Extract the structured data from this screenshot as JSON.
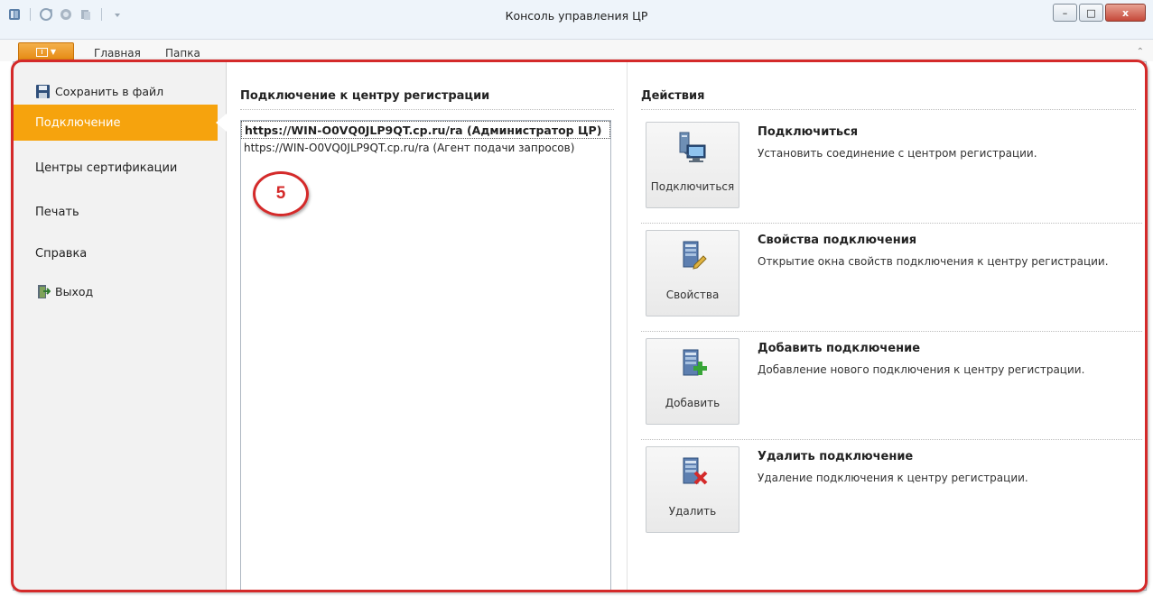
{
  "window": {
    "title": "Консоль управления ЦР",
    "buttons": {
      "minimize": "–",
      "maximize": "□",
      "close": "x"
    }
  },
  "quick_access": [
    "app-icon",
    "refresh-icon",
    "connect-icon",
    "servers-icon",
    "dropdown-icon"
  ],
  "ribbon": {
    "tabs": [
      {
        "label": "Главная"
      },
      {
        "label": "Папка"
      }
    ],
    "collapse_glyph": "⌃"
  },
  "left_nav": {
    "save": "Сохранить в файл",
    "items": [
      {
        "label": "Подключение",
        "active": true
      },
      {
        "label": "Центры сертификации"
      },
      {
        "label": "Печать"
      },
      {
        "label": "Справка"
      }
    ],
    "exit": "Выход",
    "active_color": "#f6a30d"
  },
  "connection": {
    "title": "Подключение к центру регистрации",
    "items": [
      {
        "text": "https://WIN-O0VQ0JLP9QT.cp.ru/ra (Администратор ЦР)",
        "selected": true
      },
      {
        "text": "https://WIN-O0VQ0JLP9QT.cp.ru/ra (Агент подачи запросов)",
        "selected": false
      }
    ]
  },
  "annotation": {
    "label": "5",
    "color": "#d42a2a"
  },
  "actions": {
    "title": "Действия",
    "items": [
      {
        "button": "Подключиться",
        "title": "Подключиться",
        "desc": "Установить соединение с центром регистрации.",
        "icon": "connect-computer-icon"
      },
      {
        "button": "Свойства",
        "title": "Свойства подключения",
        "desc": "Открытие окна свойств подключения к центру регистрации.",
        "icon": "server-properties-icon"
      },
      {
        "button": "Добавить",
        "title": "Добавить подключение",
        "desc": "Добавление нового подключения к центру регистрации.",
        "icon": "server-add-icon"
      },
      {
        "button": "Удалить",
        "title": "Удалить подключение",
        "desc": "Удаление подключения к центру регистрации.",
        "icon": "server-delete-icon"
      }
    ]
  }
}
